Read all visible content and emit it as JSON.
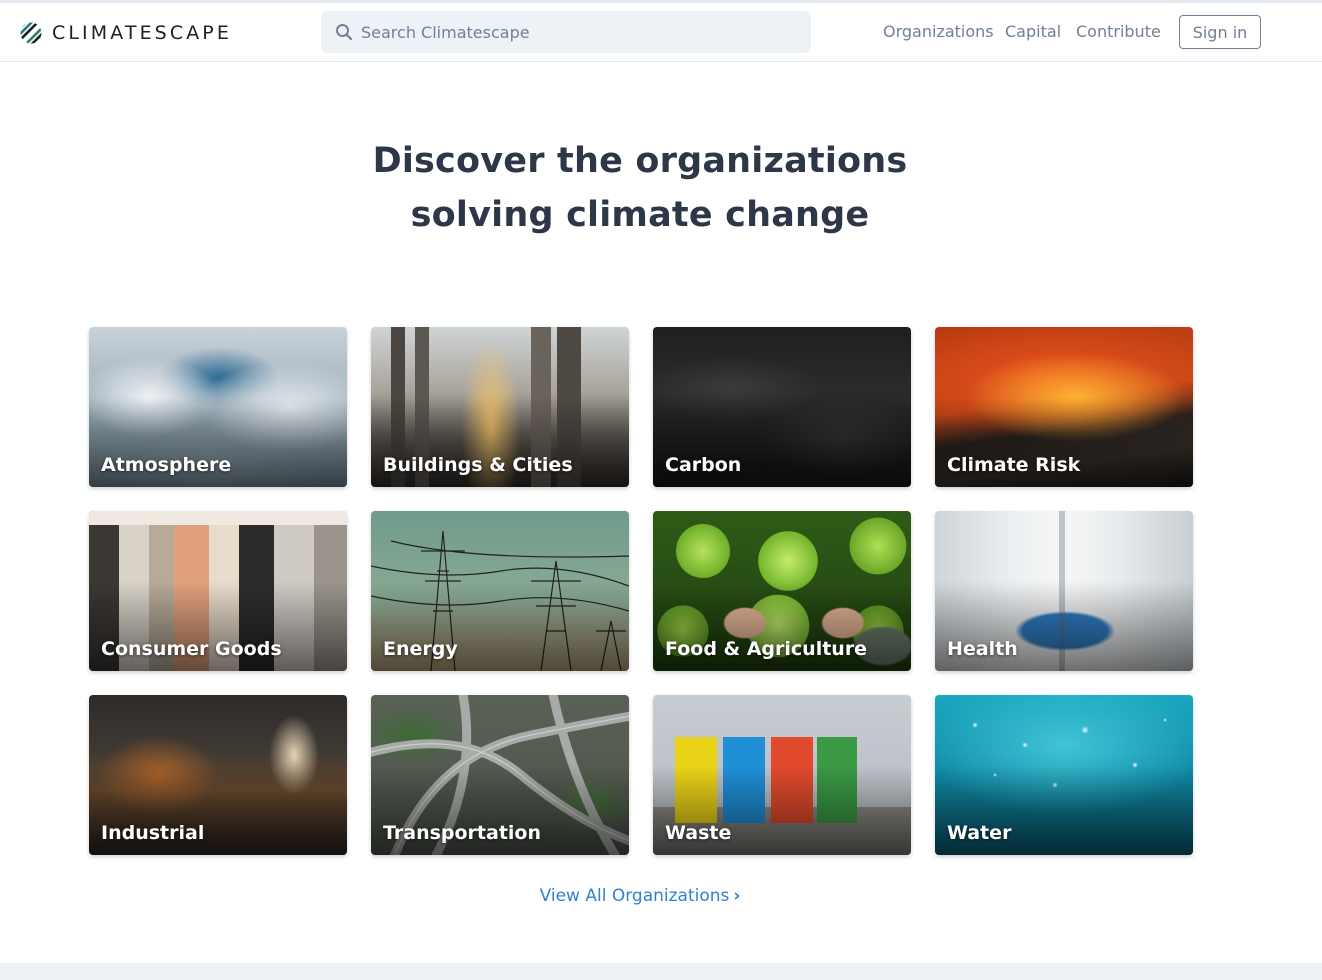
{
  "brand": {
    "name": "CLIMATESCAPE",
    "icon": "diagonal-stripes-logo-icon"
  },
  "search": {
    "placeholder": "Search Climatescape",
    "value": ""
  },
  "nav": {
    "links": [
      "Organizations",
      "Capital",
      "Contribute"
    ],
    "signin_label": "Sign in"
  },
  "hero": {
    "line1": "Discover the organizations",
    "line2": "solving climate change"
  },
  "sectors": [
    {
      "label": "Atmosphere",
      "image": "clouds-photo"
    },
    {
      "label": "Buildings & Cities",
      "image": "skyline-photo"
    },
    {
      "label": "Carbon",
      "image": "dark-rock-photo"
    },
    {
      "label": "Climate Risk",
      "image": "wildfire-photo"
    },
    {
      "label": "Consumer Goods",
      "image": "clothing-rack-photo"
    },
    {
      "label": "Energy",
      "image": "power-lines-photo"
    },
    {
      "label": "Food & Agriculture",
      "image": "lettuce-photo"
    },
    {
      "label": "Health",
      "image": "lab-coat-photo"
    },
    {
      "label": "Industrial",
      "image": "factory-photo"
    },
    {
      "label": "Transportation",
      "image": "highway-interchange-photo"
    },
    {
      "label": "Waste",
      "image": "recycling-bins-photo"
    },
    {
      "label": "Water",
      "image": "underwater-bubbles-photo"
    }
  ],
  "cta": {
    "label": "View All Organizations",
    "chevron": "›"
  },
  "colors": {
    "accent": "#3182ce",
    "heading": "#2d3748",
    "muted": "#718096",
    "search_bg": "#edf2f7"
  }
}
